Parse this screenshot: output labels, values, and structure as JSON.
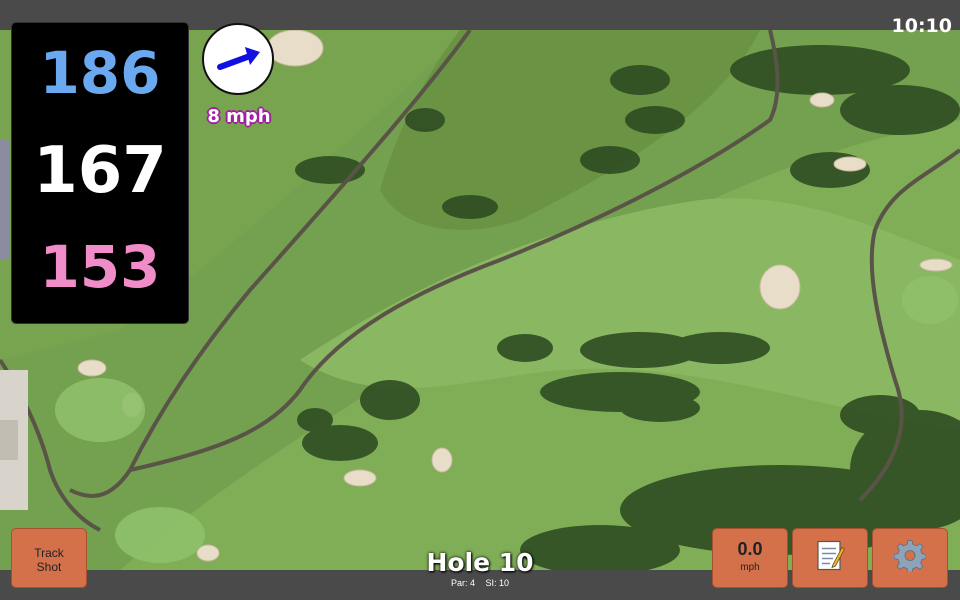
{
  "status": {
    "time": "10:10"
  },
  "distances": {
    "back": "186",
    "center": "167",
    "front": "153"
  },
  "wind": {
    "speed_label": "8 mph",
    "arrow_color": "#1010e0"
  },
  "hole": {
    "title": "Hole 10",
    "par": "Par: 4",
    "si": "SI: 10"
  },
  "buttons": {
    "track_line1": "Track",
    "track_line2": "Shot",
    "speed_value": "0.0",
    "speed_unit": "mph",
    "notes_icon": "notepad-icon",
    "settings_icon": "gear-icon"
  },
  "colors": {
    "back": "#6aa8f0",
    "center": "#ffffff",
    "front": "#f08cc7",
    "button": "#d4714a"
  }
}
